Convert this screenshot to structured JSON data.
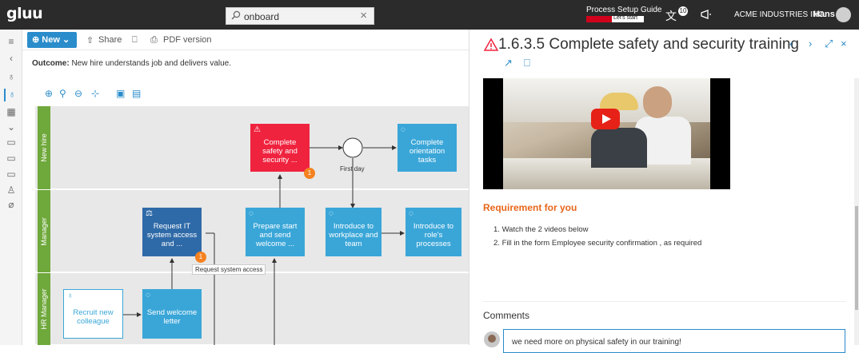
{
  "topbar": {
    "logo": "gluu",
    "search_value": "onboard",
    "guide_title": "Process Setup Guide",
    "guide_cta": "Let's start",
    "guide_progress": 0.45,
    "notification_count": "10",
    "company": "ACME INDUSTRIES INC.",
    "user": "Hans"
  },
  "toolbar": {
    "new_label": "New",
    "share_label": "Share",
    "pdf_label": "PDF version"
  },
  "outcome": {
    "label": "Outcome:",
    "text": "New hire understands job and delivers value."
  },
  "lanes": [
    "New hire",
    "Manager",
    "HR Manager"
  ],
  "boxes": {
    "complete_safety": "Complete safety and security ...",
    "complete_orientation": "Complete orientation tasks",
    "request_it": "Request IT system access and ...",
    "prepare_start": "Prepare start and send welcome ...",
    "introduce_workplace": "Introduce to workplace and team",
    "introduce_role": "Introduce to role's processes",
    "recruit": "Recruit new colleague",
    "send_welcome": "Send welcome letter"
  },
  "labels": {
    "first_day": "First day",
    "request_access": "Request system access",
    "badge_one": "1"
  },
  "detail": {
    "title": "1.6.3.5 Complete safety and security training",
    "requirement_title": "Requirement for you",
    "requirements": [
      "Watch the 2 videos below",
      "Fill in the form Employee security confirmation , as required"
    ],
    "comments_title": "Comments",
    "comment_text": "we need more on physical safety in our training!"
  },
  "colors": {
    "accent": "#2a8ccb",
    "lane": "#6fa83b",
    "task": "#3aa6d8",
    "alert": "#f0233f",
    "requirement": "#e8651a"
  }
}
